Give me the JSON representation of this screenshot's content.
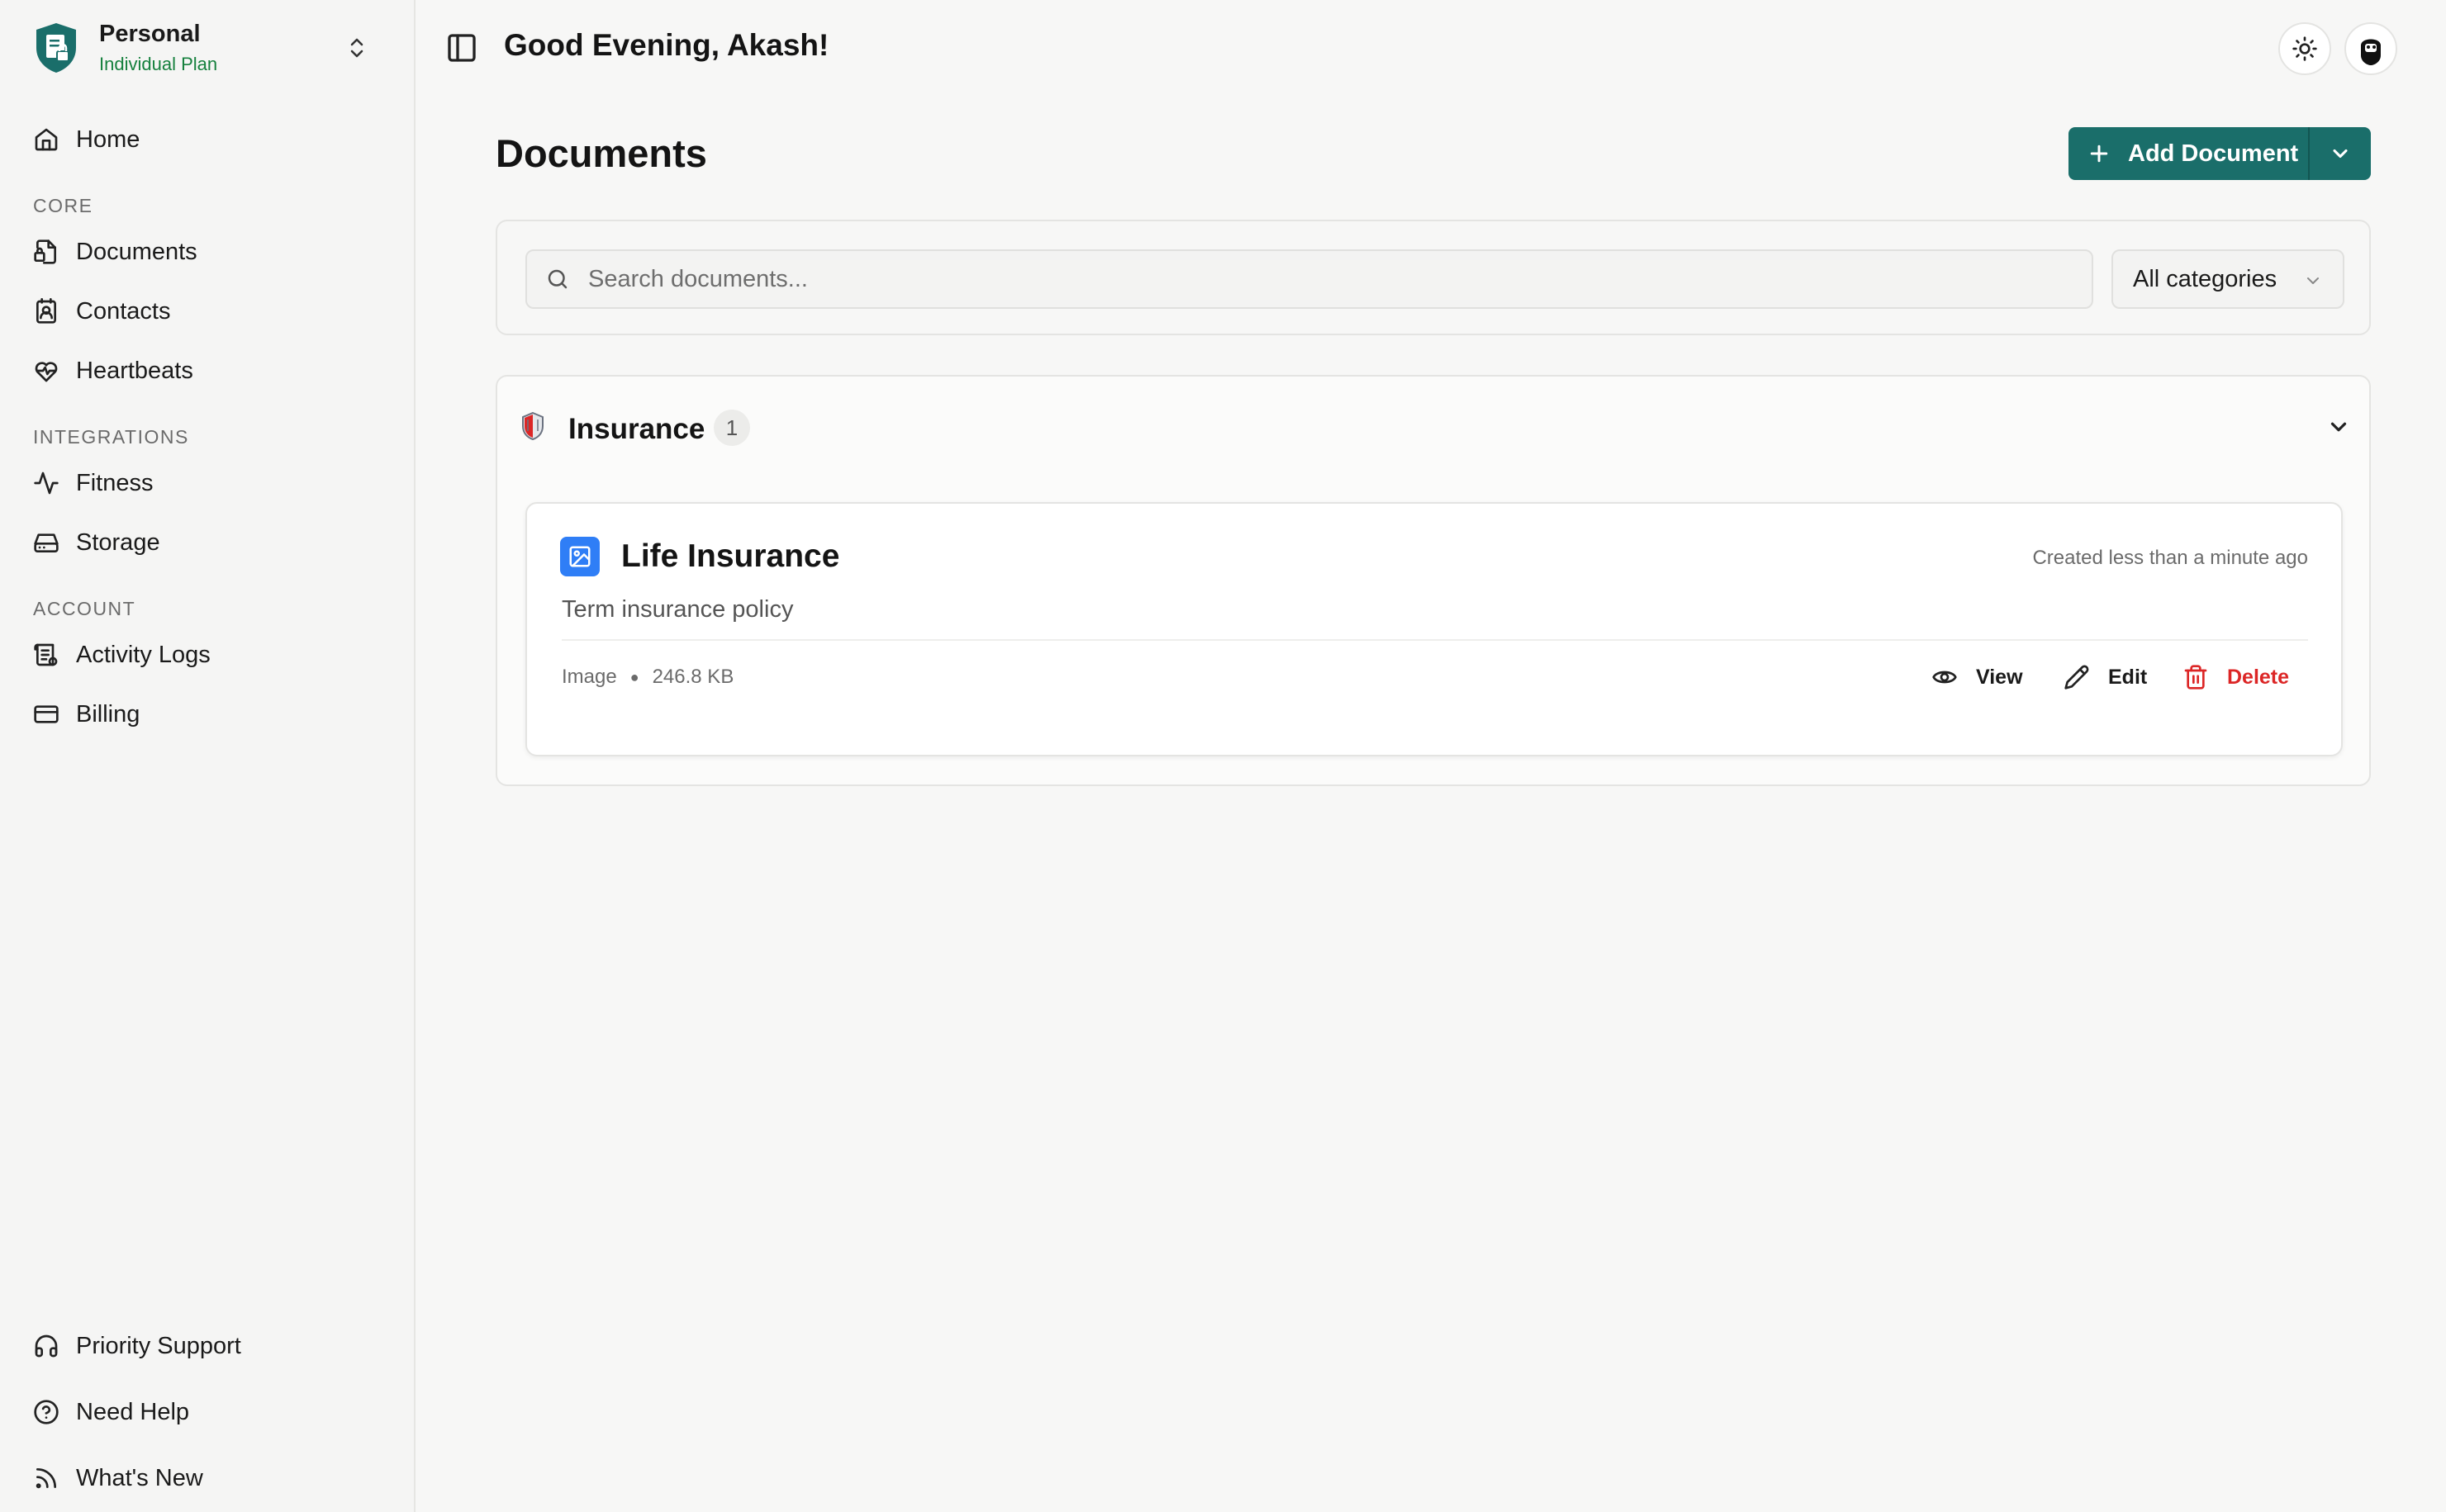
{
  "workspace": {
    "name": "Personal",
    "plan": "Individual Plan"
  },
  "nav": {
    "home": "Home",
    "sections": {
      "core": "CORE",
      "integrations": "INTEGRATIONS",
      "account": "ACCOUNT"
    },
    "core": [
      "Documents",
      "Contacts",
      "Heartbeats"
    ],
    "integrations": [
      "Fitness",
      "Storage"
    ],
    "account": [
      "Activity Logs",
      "Billing"
    ],
    "footer": [
      "Priority Support",
      "Need Help",
      "What's New"
    ]
  },
  "header": {
    "greeting": "Good Evening, Akash!"
  },
  "page": {
    "title": "Documents",
    "add_button": "Add Document"
  },
  "filters": {
    "search_placeholder": "Search documents...",
    "category": "All categories"
  },
  "groups": [
    {
      "name": "Insurance",
      "count": "1",
      "documents": [
        {
          "title": "Life Insurance",
          "description": "Term insurance policy",
          "created": "Created less than a minute ago",
          "type": "Image",
          "size": "246.8 KB",
          "actions": {
            "view": "View",
            "edit": "Edit",
            "delete": "Delete"
          }
        }
      ]
    }
  ],
  "colors": {
    "accent": "#1a6e6a",
    "plan": "#15803d",
    "danger": "#dc2626",
    "doc_icon": "#2f7ef6"
  }
}
